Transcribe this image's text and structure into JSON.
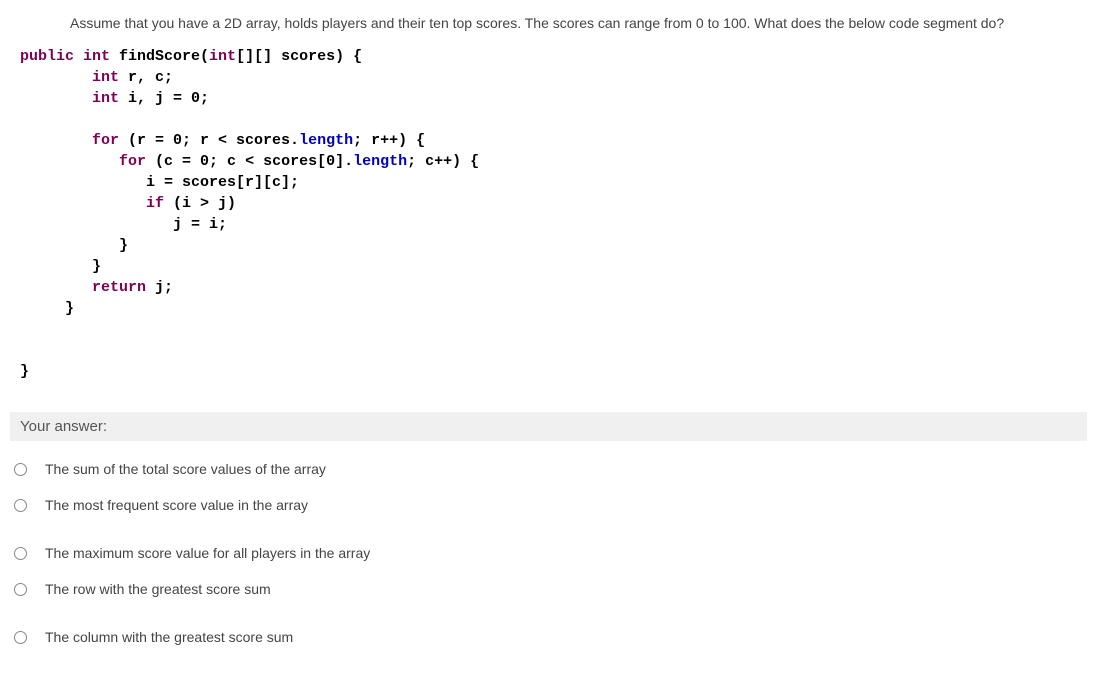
{
  "question": {
    "text": "Assume that you have a 2D array, holds players and their ten top scores. The scores can range from 0 to 100. What does the below code segment do?"
  },
  "code": {
    "line1_public": "public",
    "line1_int": " int ",
    "line1_rest": "findScore(",
    "line1_int2": "int",
    "line1_rest2": "[][] scores) {",
    "line2_int": "int",
    "line2_rest": " r, c;",
    "line3_int": "int",
    "line3_rest": " i, j = 0;",
    "line5_for": "for",
    "line5_rest": " (r = 0; r < scores.",
    "line5_length": "length",
    "line5_rest2": "; r++) {",
    "line6_for": "for",
    "line6_rest": " (c = 0; c < scores[0].",
    "line6_length": "length",
    "line6_rest2": "; c++) {",
    "line7": "i = scores[r][c];",
    "line8_if": "if",
    "line8_rest": " (i > j)",
    "line9": "j = i;",
    "line10": "}",
    "line11": "}",
    "line12_return": "return",
    "line12_rest": " j;",
    "line13": "}",
    "line_end": "}"
  },
  "answer_label": "Your answer:",
  "options": [
    "The sum of the total score values of the array",
    "The most frequent score value in the array",
    "The maximum score value for all players in the array",
    "The row with the greatest score sum",
    "The column with the greatest score sum"
  ]
}
